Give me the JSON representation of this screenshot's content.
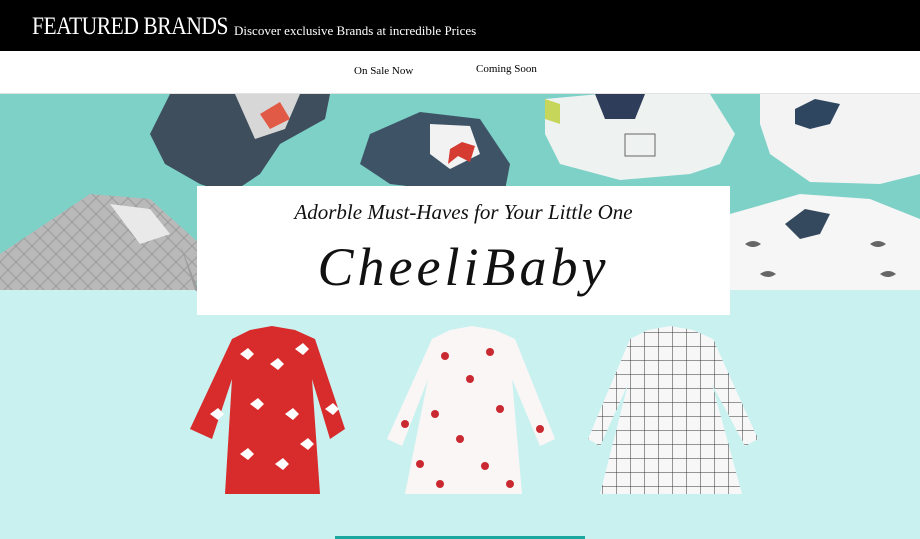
{
  "header": {
    "title": "FEATURED BRANDS",
    "tagline": "Discover exclusive Brands at incredible Prices"
  },
  "tabs": [
    {
      "label": "On Sale Now"
    },
    {
      "label": "Coming Soon"
    }
  ],
  "banner": {
    "subtitle": "Adorble Must-Haves for Your Little One",
    "brand": "CheeliBaby",
    "colors": {
      "top_background": "#7dd1c7",
      "bottom_background": "#c9f1f0"
    },
    "products": [
      {
        "icon": "red-leaf-print-dress-image"
      },
      {
        "icon": "cherry-print-dress-image"
      },
      {
        "icon": "grid-check-dress-image"
      }
    ]
  }
}
